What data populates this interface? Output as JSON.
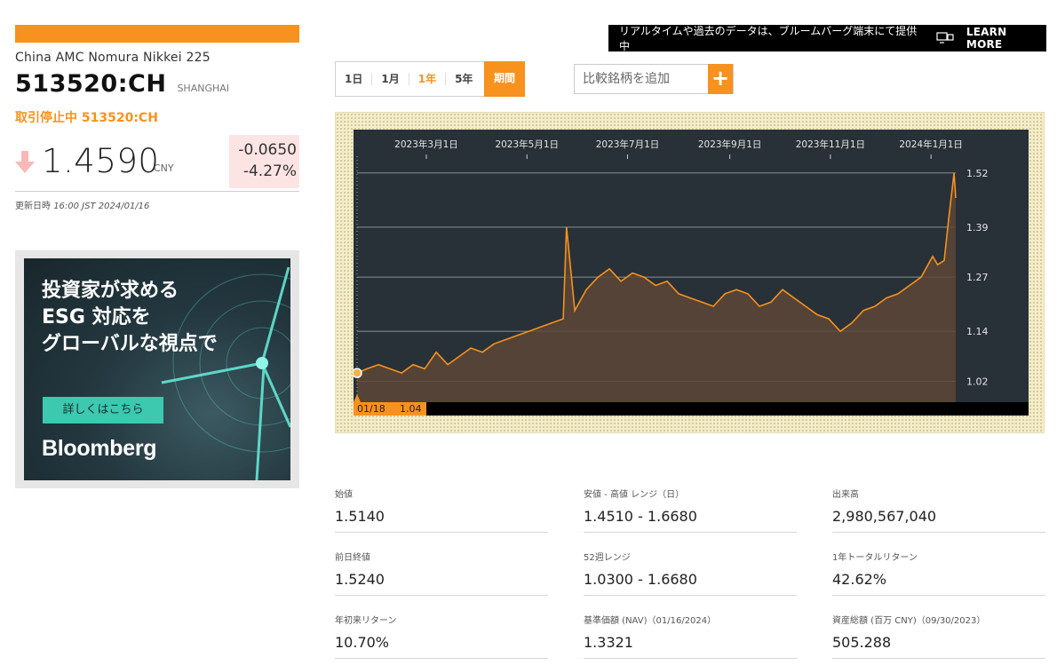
{
  "security": {
    "name": "China AMC Nomura Nikkei 225",
    "ticker": "513520:CH",
    "exchange": "SHANGHAI",
    "halt_notice": "取引停止中 513520:CH",
    "price": "1.4590",
    "currency": "CNY",
    "change": "-0.0650",
    "change_pct": "-4.27%",
    "direction": "down",
    "updated_label": "更新日時",
    "updated_time": "16:00 JST 2024/01/16"
  },
  "banner": {
    "text": "リアルタイムや過去のデータは、ブルームバーグ端末にて提供中",
    "icon": "terminal-icon",
    "learn_more": "LEARN MORE"
  },
  "range_tabs": {
    "items": [
      "1日",
      "1月",
      "1年",
      "5年"
    ],
    "active": "1年",
    "period_label": "期間"
  },
  "compare": {
    "placeholder": "比較銘柄を追加",
    "button": "+"
  },
  "ad": {
    "headline": [
      "投資家が求める",
      "ESG 対応を",
      "グローバルな視点で"
    ],
    "button": "詳しくはこちら",
    "brand": "Bloomberg"
  },
  "stats": [
    {
      "label": "始値",
      "value": "1.5140"
    },
    {
      "label": "安値 - 高値 レンジ（日）",
      "value": "1.4510 - 1.6680"
    },
    {
      "label": "出来高",
      "value": "2,980,567,040"
    },
    {
      "label": "前日終値",
      "value": "1.5240"
    },
    {
      "label": "52週レンジ",
      "value": "1.0300 - 1.6680"
    },
    {
      "label": "1年トータルリターン",
      "value": "42.62%"
    },
    {
      "label": "年初来リターン",
      "value": "10.70%"
    },
    {
      "label": "基準価額 (NAV)（01/16/2024）",
      "value": "1.3321"
    },
    {
      "label": "資産総額 (百万 CNY)（09/30/2023）",
      "value": "505.288"
    }
  ],
  "colors": {
    "accent": "#f7921e",
    "chart_bg": "#283038",
    "change_bg": "#fde4e4"
  },
  "chart_data": {
    "type": "area",
    "x_ticks": [
      "2023年3月1日",
      "2023年5月1日",
      "2023年7月1日",
      "2023年9月1日",
      "2023年11月1日",
      "2024年1月1日"
    ],
    "y_ticks": [
      "1.52",
      "1.39",
      "1.27",
      "1.14",
      "1.02"
    ],
    "ylim": [
      0.97,
      1.56
    ],
    "xlim": [
      "2023-01-18",
      "2024-01-16"
    ],
    "cursor": {
      "date_label": "01/18",
      "value_label": "1.04"
    },
    "series": [
      {
        "x": [
          "2023-01-18",
          "2023-01-24",
          "2023-01-31",
          "2023-02-07",
          "2023-02-14",
          "2023-02-21",
          "2023-02-28",
          "2023-03-07",
          "2023-03-14",
          "2023-03-21",
          "2023-03-28",
          "2023-04-04",
          "2023-04-11",
          "2023-04-18",
          "2023-04-25",
          "2023-05-02",
          "2023-05-09",
          "2023-05-16",
          "2023-05-23",
          "2023-05-25",
          "2023-05-30",
          "2023-06-06",
          "2023-06-13",
          "2023-06-20",
          "2023-06-27",
          "2023-07-04",
          "2023-07-11",
          "2023-07-18",
          "2023-07-25",
          "2023-08-01",
          "2023-08-08",
          "2023-08-15",
          "2023-08-22",
          "2023-08-29",
          "2023-09-05",
          "2023-09-12",
          "2023-09-19",
          "2023-09-26",
          "2023-10-03",
          "2023-10-10",
          "2023-10-17",
          "2023-10-24",
          "2023-10-31",
          "2023-11-07",
          "2023-11-14",
          "2023-11-21",
          "2023-11-28",
          "2023-12-05",
          "2023-12-12",
          "2023-12-19",
          "2023-12-26",
          "2024-01-02",
          "2024-01-05",
          "2024-01-09",
          "2024-01-12",
          "2024-01-15",
          "2024-01-16"
        ],
        "values": [
          1.04,
          1.05,
          1.06,
          1.05,
          1.04,
          1.06,
          1.05,
          1.09,
          1.06,
          1.08,
          1.1,
          1.09,
          1.11,
          1.12,
          1.13,
          1.14,
          1.15,
          1.16,
          1.17,
          1.39,
          1.19,
          1.24,
          1.27,
          1.29,
          1.26,
          1.28,
          1.27,
          1.25,
          1.26,
          1.23,
          1.22,
          1.21,
          1.2,
          1.23,
          1.24,
          1.23,
          1.2,
          1.21,
          1.24,
          1.22,
          1.2,
          1.18,
          1.17,
          1.14,
          1.16,
          1.19,
          1.2,
          1.22,
          1.23,
          1.25,
          1.27,
          1.32,
          1.3,
          1.31,
          1.42,
          1.52,
          1.46
        ]
      }
    ]
  }
}
